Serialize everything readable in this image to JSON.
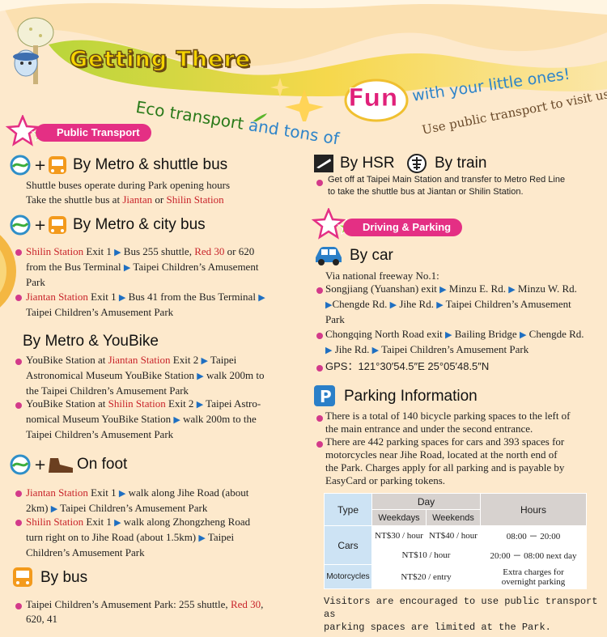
{
  "header": {
    "title": "Getting There",
    "slogan_part1": "Eco transport",
    "slogan_part2": "and tons of",
    "slogan_fun": "Fun",
    "slogan_part3": "with your little ones!",
    "slogan_sub": "Use public transport to visit us"
  },
  "left": {
    "section_label": "Public Transport",
    "metro_shuttle": {
      "heading": "By Metro & shuttle bus",
      "line1": "Shuttle buses operate during Park opening hours",
      "line2a": "Take the shuttle bus at ",
      "line2_red1": "Jiantan",
      "line2_or": " or ",
      "line2_red2": "Shilin Station"
    },
    "metro_city": {
      "heading": "By Metro & city bus",
      "b1_red": "Shilin Station",
      "b1_t1": " Exit 1 ",
      "b1_t2": " Bus 255 shuttle, ",
      "b1_red2": "Red 30",
      "b1_t3": " or 620",
      "b1_l2": "from the Bus Terminal ",
      "b1_l2b": " Taipei Children’s Amusement",
      "b1_l3": "Park",
      "b2_red": "Jiantan Station",
      "b2_t1": " Exit 1 ",
      "b2_t2": " Bus 41 from the Bus Terminal ",
      "b2_l2": " Taipei Children’s Amusement Park"
    },
    "youbike": {
      "heading": "By Metro & YouBike",
      "b1_t1": "YouBike Station at ",
      "b1_red": "Jiantan Station",
      "b1_t2": " Exit 2 ",
      "b1_t3": " Taipei",
      "b1_l2": "Astronomical Museum YouBike Station ",
      "b1_l2b": " walk 200m to",
      "b1_l3": "the Taipei Children’s Amusement Park",
      "b2_t1": "YouBike Station at ",
      "b2_red": "Shilin Station",
      "b2_t2": " Exit 2 ",
      "b2_t3": " Taipei Astro-",
      "b2_l2": "nomical Museum YouBike Station ",
      "b2_l2b": " walk 200m to the",
      "b2_l3": "Taipei Children’s Amusement Park"
    },
    "foot": {
      "heading": "On foot",
      "b1_red": "Jiantan Station",
      "b1_t1": " Exit 1 ",
      "b1_t2": " walk along Jihe Road (about",
      "b1_l2": "2km) ",
      "b1_l2b": " Taipei Children’s Amusement Park",
      "b2_red": "Shilin Station",
      "b2_t1": " Exit 1 ",
      "b2_t2": " walk along Zhongzheng Road",
      "b2_l2": "turn right on to Jihe Road (about 1.5km) ",
      "b2_l2b": " Taipei",
      "b2_l3": "Children’s Amusement Park"
    },
    "bus": {
      "heading": "By bus",
      "b1_t1": "Taipei Children’s Amusement Park: 255 shuttle, ",
      "b1_red": "Red 30",
      "b1_t2": ",",
      "b1_l2": "620, 41"
    }
  },
  "right": {
    "hsr_heading": "By HSR",
    "train_heading": "By train",
    "hsr_l1": "Get off at Taipei Main Station and transfer to Metro Red Line",
    "hsr_l2": "to take the shuttle bus at Jiantan or Shilin Station.",
    "section_label": "Driving & Parking",
    "car": {
      "heading": "By car",
      "intro": "Via national freeway No.1:",
      "b1_t1": "Songjiang (Yuanshan) exit ",
      "b1_t2": " Minzu E. Rd. ",
      "b1_t3": " Minzu W. Rd.",
      "b1_l2b": "Chengde Rd. ",
      "b1_l2c": " Jihe Rd. ",
      "b1_l2d": " Taipei Children’s Amusement",
      "b1_l3": "Park",
      "b2_t1": "Chongqing North Road exit ",
      "b2_t2": " Bailing Bridge ",
      "b2_t3": " Chengde Rd.",
      "b2_l2b": " Jihe Rd. ",
      "b2_l2c": " Taipei Children’s Amusement Park",
      "gps": "GPS：121°30′54.5″E  25°05′48.5″N"
    },
    "parking": {
      "heading": "Parking Information",
      "b1_l1": "There is a total of 140 bicycle parking spaces to the left of",
      "b1_l2": "the main entrance and under the second entrance.",
      "b2_l1": "There are 442 parking spaces for cars and 393 spaces for",
      "b2_l2": "motorcycles near Jihe Road, located at the north end of",
      "b2_l3": "the Park. Charges apply for all parking and is payable by",
      "b2_l4": "EasyCard or parking tokens."
    },
    "table": {
      "type": "Type",
      "day": "Day",
      "weekdays": "Weekdays",
      "weekends": "Weekends",
      "hours": "Hours",
      "cars": "Cars",
      "cars_wd": "NT$30 / hour",
      "cars_we": "NT$40 / hour",
      "cars_h1": "08:00 － 20:00",
      "cars_night": "NT$10 / hour",
      "cars_h2": "20:00 － 08:00 next day",
      "moto": "Motorcycles",
      "moto_price": "NT$20 / entry",
      "moto_h1": "Extra charges for",
      "moto_h2": "overnight parking"
    },
    "footer_l1": "Visitors are encouraged to use public transport as",
    "footer_l2": "parking spaces are limited at the Park."
  },
  "colors": {
    "accent": "#e42f84",
    "link_red": "#c8232a",
    "arrow": "#1f6fc1",
    "bg": "#fde9cc"
  }
}
